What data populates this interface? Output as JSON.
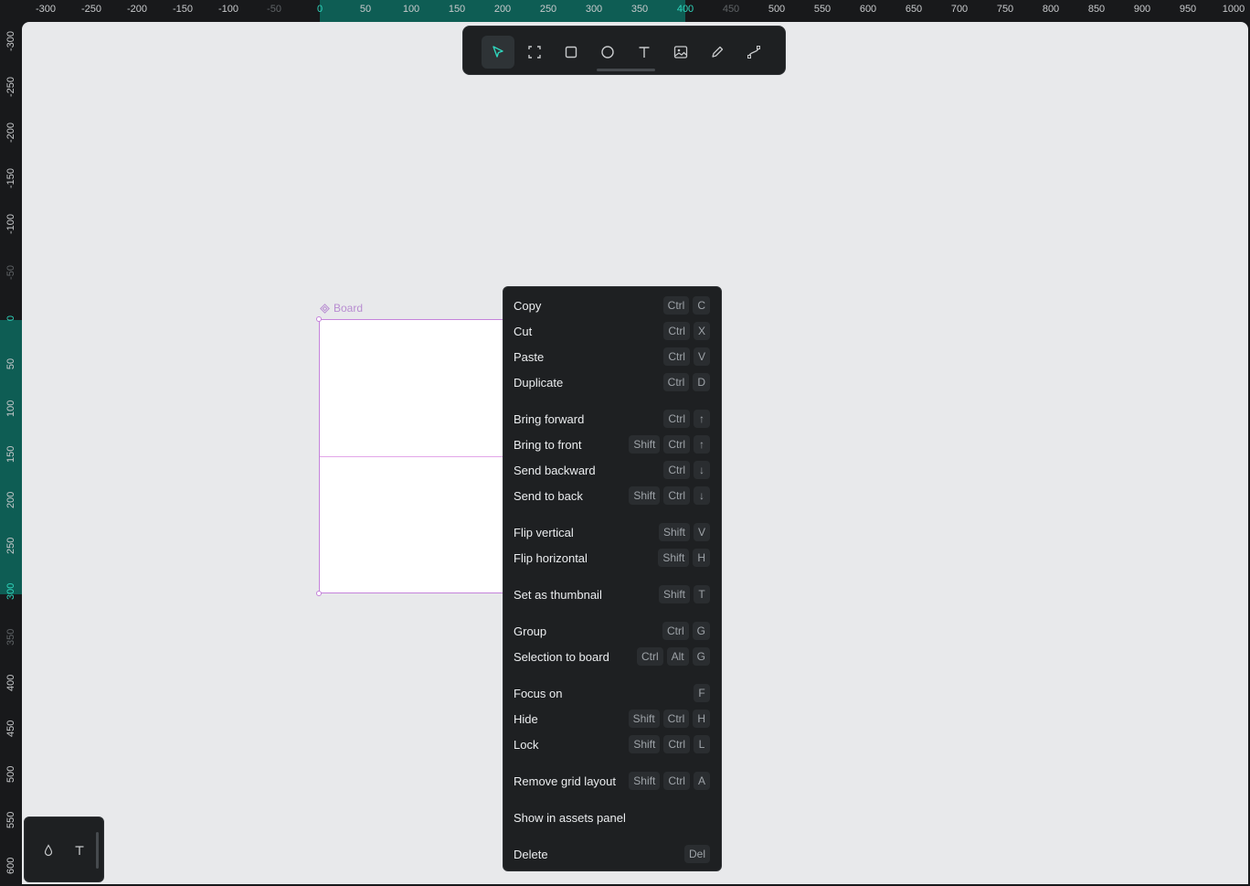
{
  "ruler": {
    "top_ticks": [
      "-300",
      "-250",
      "-200",
      "-150",
      "-100",
      "-50",
      "0",
      "50",
      "100",
      "150",
      "200",
      "250",
      "300",
      "350",
      "400",
      "450",
      "500",
      "550",
      "600",
      "650",
      "700",
      "750",
      "800",
      "850",
      "900",
      "950",
      "1000"
    ],
    "left_ticks": [
      "-300",
      "-250",
      "-200",
      "-150",
      "-100",
      "-50",
      "0",
      "50",
      "100",
      "150",
      "200",
      "250",
      "300",
      "350",
      "400",
      "450",
      "500",
      "550",
      "600"
    ]
  },
  "toolbar": {
    "tools": [
      {
        "name": "move-tool",
        "icon": "pointer-icon",
        "active": true
      },
      {
        "name": "board-tool",
        "icon": "frame-icon"
      },
      {
        "name": "rectangle-tool",
        "icon": "rectangle-icon"
      },
      {
        "name": "ellipse-tool",
        "icon": "ellipse-icon"
      },
      {
        "name": "text-tool",
        "icon": "text-icon"
      },
      {
        "name": "image-tool",
        "icon": "image-icon"
      },
      {
        "name": "pencil-tool",
        "icon": "pencil-icon"
      },
      {
        "name": "path-tool",
        "icon": "path-icon"
      }
    ]
  },
  "board": {
    "label": "Board"
  },
  "context_menu": {
    "items": [
      {
        "label": "Copy",
        "keys": [
          "Ctrl",
          "C"
        ]
      },
      {
        "label": "Cut",
        "keys": [
          "Ctrl",
          "X"
        ]
      },
      {
        "label": "Paste",
        "keys": [
          "Ctrl",
          "V"
        ]
      },
      {
        "label": "Duplicate",
        "keys": [
          "Ctrl",
          "D"
        ]
      },
      {
        "sep": true
      },
      {
        "label": "Bring forward",
        "keys": [
          "Ctrl",
          "↑"
        ]
      },
      {
        "label": "Bring to front",
        "keys": [
          "Shift",
          "Ctrl",
          "↑"
        ]
      },
      {
        "label": "Send backward",
        "keys": [
          "Ctrl",
          "↓"
        ]
      },
      {
        "label": "Send to back",
        "keys": [
          "Shift",
          "Ctrl",
          "↓"
        ]
      },
      {
        "sep": true
      },
      {
        "label": "Flip vertical",
        "keys": [
          "Shift",
          "V"
        ]
      },
      {
        "label": "Flip horizontal",
        "keys": [
          "Shift",
          "H"
        ]
      },
      {
        "sep": true
      },
      {
        "label": "Set as thumbnail",
        "keys": [
          "Shift",
          "T"
        ]
      },
      {
        "sep": true
      },
      {
        "label": "Group",
        "keys": [
          "Ctrl",
          "G"
        ]
      },
      {
        "label": "Selection to board",
        "keys": [
          "Ctrl",
          "Alt",
          "G"
        ]
      },
      {
        "sep": true
      },
      {
        "label": "Focus on",
        "keys": [
          "F"
        ]
      },
      {
        "label": "Hide",
        "keys": [
          "Shift",
          "Ctrl",
          "H"
        ]
      },
      {
        "label": "Lock",
        "keys": [
          "Shift",
          "Ctrl",
          "L"
        ]
      },
      {
        "sep": true
      },
      {
        "label": "Remove grid layout",
        "keys": [
          "Shift",
          "Ctrl",
          "A"
        ]
      },
      {
        "sep": true
      },
      {
        "label": "Show in assets panel",
        "keys": []
      },
      {
        "sep": true
      },
      {
        "label": "Delete",
        "keys": [
          "Del"
        ]
      }
    ]
  },
  "palette": {
    "buttons": [
      {
        "name": "color-palette-button",
        "icon": "droplet-icon",
        "glyph": "◊"
      },
      {
        "name": "typography-palette-button",
        "icon": "text-icon",
        "glyph": "T"
      }
    ]
  },
  "colors": {
    "accent": "#2fd6bd",
    "board": "#c583db",
    "canvas": "#e8e9eb",
    "panel": "#1e2022"
  }
}
